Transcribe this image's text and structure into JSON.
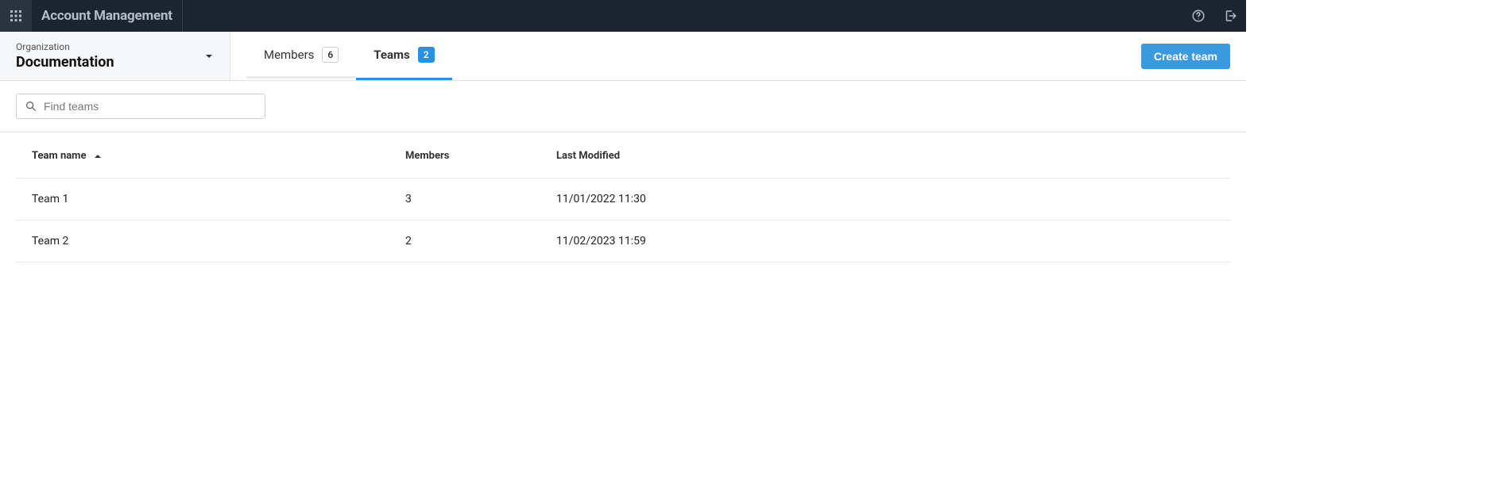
{
  "header": {
    "app_title": "Account Management"
  },
  "org": {
    "label": "Organization",
    "name": "Documentation"
  },
  "tabs": {
    "members": {
      "label": "Members",
      "count": "6"
    },
    "teams": {
      "label": "Teams",
      "count": "2"
    }
  },
  "actions": {
    "create_team_label": "Create team"
  },
  "search": {
    "placeholder": "Find teams",
    "value": ""
  },
  "table": {
    "columns": {
      "team_name": "Team name",
      "members": "Members",
      "last_modified": "Last Modified"
    },
    "rows": [
      {
        "name": "Team 1",
        "members": "3",
        "last_modified": "11/01/2022 11:30"
      },
      {
        "name": "Team 2",
        "members": "2",
        "last_modified": "11/02/2023 11:59"
      }
    ]
  }
}
